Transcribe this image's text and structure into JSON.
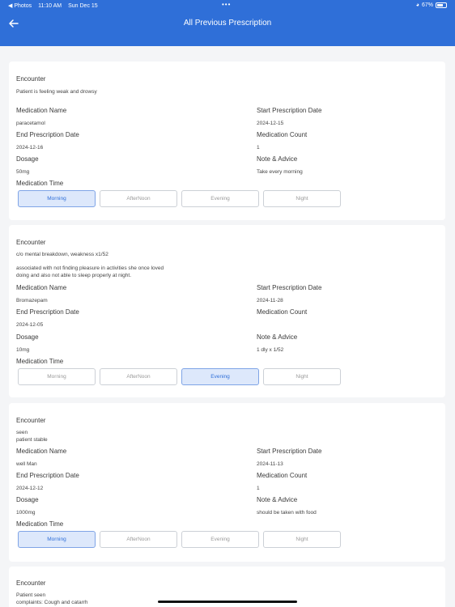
{
  "status_bar": {
    "app": "◀ Photos",
    "time": "11:10 AM",
    "date": "Sun Dec 15",
    "battery": "67%"
  },
  "header": {
    "title": "All Previous Prescription"
  },
  "labels": {
    "encounter": "Encounter",
    "medication_name": "Medication Name",
    "start_date": "Start Prescription Date",
    "end_date": "End Prescription Date",
    "medication_count": "Medication Count",
    "dosage": "Dosage",
    "note": "Note & Advice",
    "medication_time": "Medication Time"
  },
  "time_options": [
    "Morning",
    "AfterNoon",
    "Evening",
    "Night"
  ],
  "prescriptions": [
    {
      "encounter": [
        "Patient is feeling weak and drowsy"
      ],
      "medication_name": "paracetamol",
      "start_date": "2024-12-15",
      "end_date": "2024-12-16",
      "medication_count": "1",
      "dosage": "50mg",
      "note": "Take every morning",
      "selected_time": "Morning"
    },
    {
      "encounter": [
        "c/o mental breakdown, weakness x1/52",
        "",
        "associated with not finding pleasure in activities she once loved",
        "doing and also not able to sleep properly at night."
      ],
      "medication_name": "Bromazepam",
      "start_date": "2024-11-28",
      "end_date": "2024-12-05",
      "medication_count": "",
      "dosage": "10mg",
      "note": "1 dly x 1/52",
      "selected_time": "Evening"
    },
    {
      "encounter": [
        "seen",
        "patient stable"
      ],
      "medication_name": "well Man",
      "start_date": "2024-11-13",
      "end_date": "2024-12-12",
      "medication_count": "1",
      "dosage": "1000mg",
      "note": "should be taken with food",
      "selected_time": "Morning"
    },
    {
      "encounter": [
        "Patient seen",
        "complaints: Cough and catarrh"
      ]
    }
  ]
}
